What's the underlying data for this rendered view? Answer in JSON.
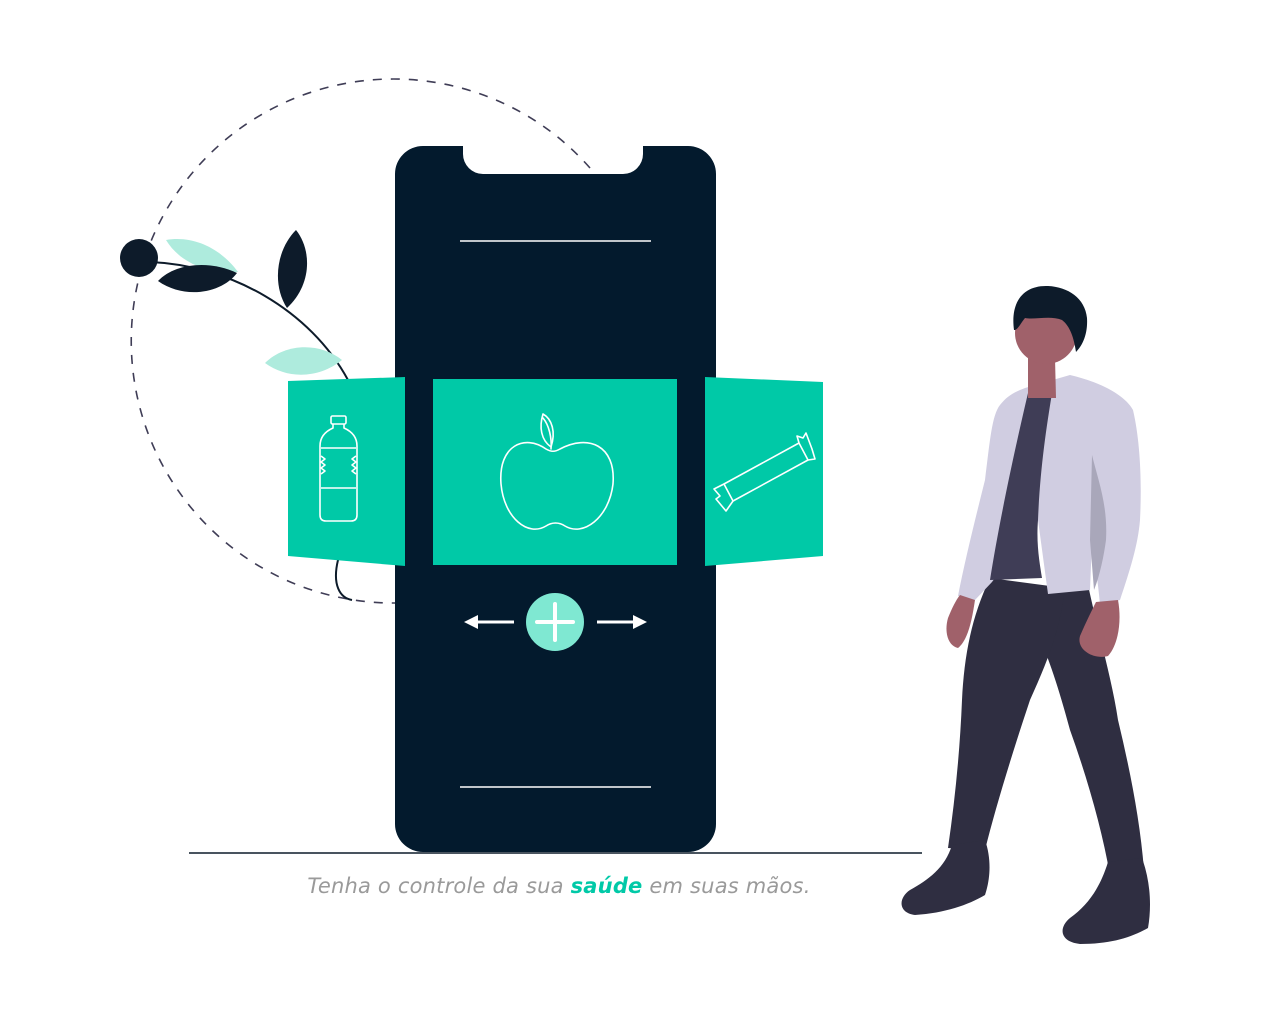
{
  "caption": {
    "before": "Tenha o controle da sua",
    "highlight": "saúde",
    "after": "em suas mãos."
  },
  "colors": {
    "accent": "#00C9A7",
    "accent_light": "#7FE8D2",
    "leaf_light": "#AEEBDD",
    "phone": "#031A2D",
    "dark": "#0D1B2A",
    "skin": "#A0616A",
    "shirt": "#3F3D56",
    "jacket": "#D0CDE1",
    "pants": "#2F2E41",
    "caption_text": "#9A9A9A"
  },
  "icons": {
    "left_card": "water-bottle-icon",
    "center_card": "apple-icon",
    "right_card": "snack-bar-icon",
    "add_button": "plus-icon",
    "arrow_left": "arrow-left-icon",
    "arrow_right": "arrow-right-icon"
  }
}
